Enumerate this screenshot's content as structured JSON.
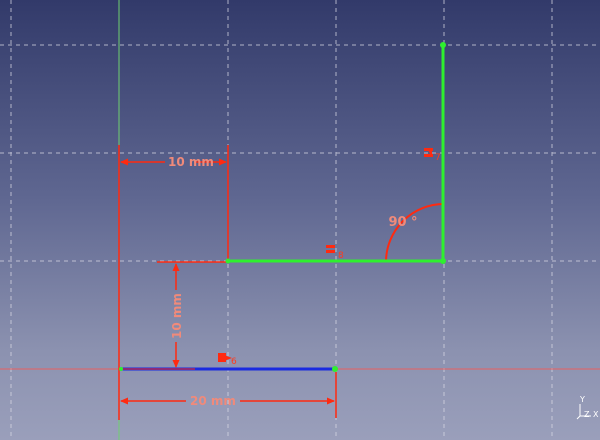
{
  "sketch": {
    "dimensions": {
      "top_horizontal": "10 mm",
      "vertical": "10 mm",
      "bottom_horizontal": "20 mm"
    },
    "angle": "90 °",
    "constraint_indices": {
      "vertical_constraint": "7",
      "horizontal_constraint": "8",
      "lower_constraint": "6"
    }
  },
  "navigation_cube": {
    "x_label": "X",
    "y_label": "Y",
    "z_label": "Z"
  },
  "colors": {
    "green_geometry": "#2ef02e",
    "blue_line": "#1a2ae0",
    "constraint_red": "#ff2a10",
    "dimension_text": "#f08a7a",
    "grid": "#d8d8e4"
  }
}
